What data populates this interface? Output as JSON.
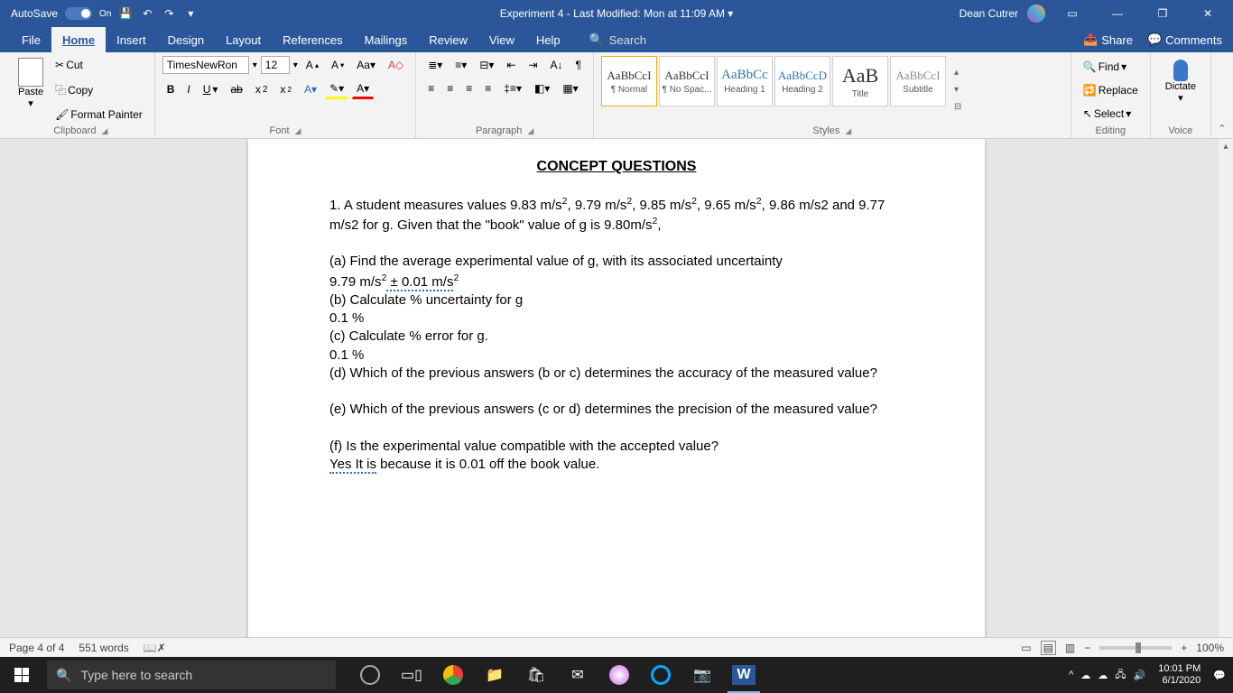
{
  "titlebar": {
    "autosave_label": "AutoSave",
    "autosave_on": "On",
    "doc_title": "Experiment 4 - Last Modified: Mon at 11:09 AM",
    "user_name": "Dean Cutrer"
  },
  "tabs": {
    "file": "File",
    "home": "Home",
    "insert": "Insert",
    "design": "Design",
    "layout": "Layout",
    "references": "References",
    "mailings": "Mailings",
    "review": "Review",
    "view": "View",
    "help": "Help",
    "search": "Search",
    "share": "Share",
    "comments": "Comments"
  },
  "ribbon": {
    "clipboard": {
      "label": "Clipboard",
      "paste": "Paste",
      "cut": "Cut",
      "copy": "Copy",
      "format_painter": "Format Painter"
    },
    "font": {
      "label": "Font",
      "name": "TimesNewRon",
      "size": "12"
    },
    "paragraph": {
      "label": "Paragraph"
    },
    "styles": {
      "label": "Styles",
      "items": [
        {
          "preview": "AaBbCcI",
          "name": "¶ Normal"
        },
        {
          "preview": "AaBbCcI",
          "name": "¶ No Spac..."
        },
        {
          "preview": "AaBbCc",
          "name": "Heading 1"
        },
        {
          "preview": "AaBbCcD",
          "name": "Heading 2"
        },
        {
          "preview": "AaB",
          "name": "Title"
        },
        {
          "preview": "AaBbCcI",
          "name": "Subtitle"
        }
      ]
    },
    "editing": {
      "label": "Editing",
      "find": "Find",
      "replace": "Replace",
      "select": "Select"
    },
    "voice": {
      "label": "Voice",
      "dictate": "Dictate"
    }
  },
  "document": {
    "title": "CONCEPT QUESTIONS",
    "q1_intro_a": "1.  A student measures values 9.83 m/s",
    "q1_intro_b": ", 9.79 m/s",
    "q1_intro_c": ", 9.85 m/s",
    "q1_intro_d": ", 9.65 m/s",
    "q1_intro_e": ", 9.86 m/s2 and 9.77 m/s2 for g. Given that the \"book\" value of g is 9.80m/s",
    "q1_intro_f": ",",
    "a_q": "(a) Find the average experimental value of g, with its associated uncertainty",
    "a_ans_pre": "9.79 m/s",
    "a_ans_post": " ± 0.01 m/s",
    "b_q": "(b) Calculate % uncertainty for g",
    "b_ans": "0.1 %",
    "c_q": "(c) Calculate % error for g.",
    "c_ans": "0.1 %",
    "d_q": "(d) Which of the previous answers (b or c) determines the accuracy of the measured value?",
    "e_q": "(e) Which of the previous answers (c or d) determines the precision of the measured value?",
    "f_q": "(f) Is the experimental value compatible with the accepted value?",
    "f_ans_flag": "Yes It is",
    "f_ans_rest": " because it is 0.01 off the book value."
  },
  "statusbar": {
    "page": "Page 4 of 4",
    "words": "551 words",
    "zoom": "100%"
  },
  "taskbar": {
    "search_placeholder": "Type here to search",
    "time": "10:01 PM",
    "date": "6/1/2020"
  }
}
